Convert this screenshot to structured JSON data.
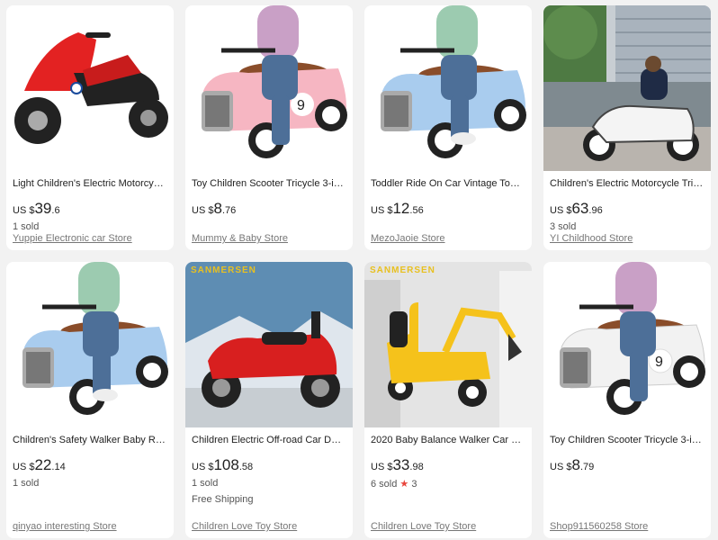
{
  "products": [
    {
      "title": "Light Children's Electric Motorcycle...",
      "currency": "US $",
      "price_int": "39",
      "price_dec": ".6",
      "sold": "1 sold",
      "shipping": "",
      "rating": "",
      "store": "Yuppie Electronic car Store"
    },
    {
      "title": "Toy Children Scooter Tricycle 3-in-...",
      "currency": "US $",
      "price_int": "8",
      "price_dec": ".76",
      "sold": "",
      "shipping": "",
      "rating": "",
      "store": "Mummy & Baby Store"
    },
    {
      "title": "Toddler Ride On Car Vintage Toddl...",
      "currency": "US $",
      "price_int": "12",
      "price_dec": ".56",
      "sold": "",
      "shipping": "",
      "rating": "",
      "store": "MezoJaoie Store"
    },
    {
      "title": "Children's Electric Motorcycle Tricy...",
      "currency": "US $",
      "price_int": "63",
      "price_dec": ".96",
      "sold": "3 sold",
      "shipping": "",
      "rating": "",
      "store": "YI Childhood Store"
    },
    {
      "title": "Children's Safety Walker Baby Ride-...",
      "currency": "US $",
      "price_int": "22",
      "price_dec": ".14",
      "sold": "1 sold",
      "shipping": "",
      "rating": "",
      "store": "qinyao interesting Store"
    },
    {
      "title": "Children Electric Off-road Car Dual...",
      "currency": "US $",
      "price_int": "108",
      "price_dec": ".58",
      "sold": "1 sold",
      "shipping": "Free Shipping",
      "rating": "",
      "store": "Children Love Toy Store"
    },
    {
      "title": "2020 Baby Balance Walker Car Lar...",
      "currency": "US $",
      "price_int": "33",
      "price_dec": ".98",
      "sold": "6 sold",
      "shipping": "",
      "rating": "3",
      "store": "Children Love Toy Store"
    },
    {
      "title": "Toy Children Scooter Tricycle 3-in-...",
      "currency": "US $",
      "price_int": "8",
      "price_dec": ".79",
      "sold": "",
      "shipping": "",
      "rating": "",
      "store": "Shop911560258 Store"
    }
  ],
  "brand_overlay": "SANMERSEN",
  "colors": {
    "accent": "#e8453c",
    "card_bg": "#ffffff",
    "page_bg": "#f2f2f2"
  }
}
